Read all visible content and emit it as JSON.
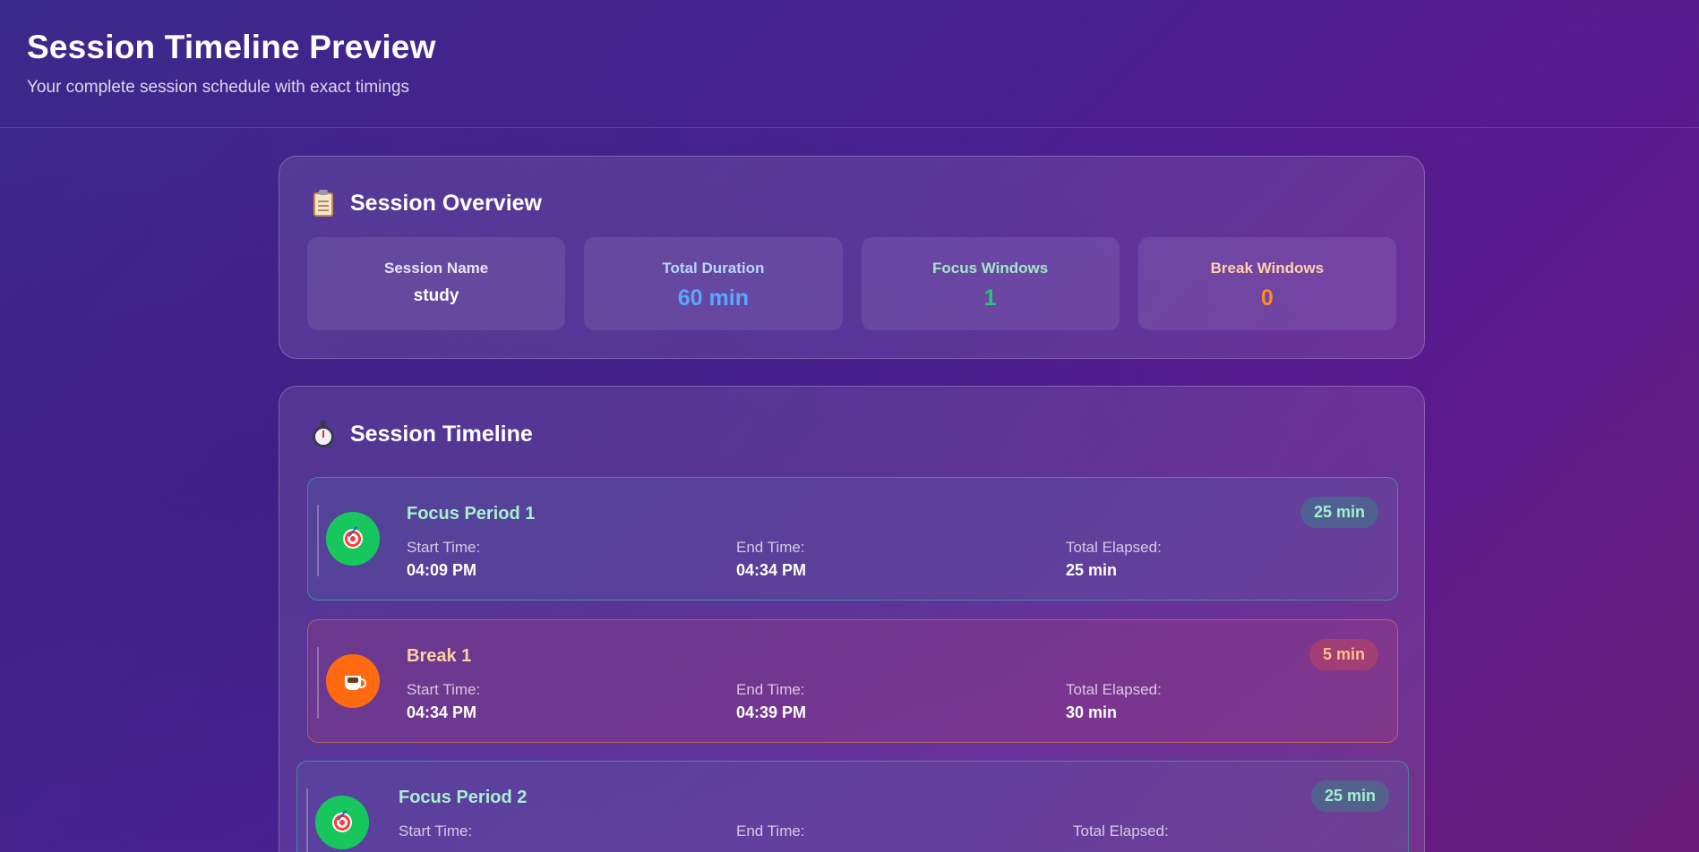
{
  "header": {
    "title": "Session Timeline Preview",
    "subtitle": "Your complete session schedule with exact timings"
  },
  "overview": {
    "heading": "Session Overview",
    "heading_icon": "clipboard-icon",
    "stats": [
      {
        "label": "Session Name",
        "value": "study"
      },
      {
        "label": "Total Duration",
        "value": "60 min"
      },
      {
        "label": "Focus Windows",
        "value": "1"
      },
      {
        "label": "Break Windows",
        "value": "0"
      }
    ]
  },
  "timeline": {
    "heading": "Session Timeline",
    "heading_icon": "stopwatch-icon",
    "periods": [
      {
        "type": "focus",
        "icon": "target-icon",
        "title": "Focus Period 1",
        "badge": "25 min",
        "start_label": "Start Time:",
        "start": "04:09 PM",
        "end_label": "End Time:",
        "end": "04:34 PM",
        "elapsed_label": "Total Elapsed:",
        "elapsed": "25 min"
      },
      {
        "type": "break",
        "icon": "coffee-icon",
        "title": "Break 1",
        "badge": "5 min",
        "start_label": "Start Time:",
        "start": "04:34 PM",
        "end_label": "End Time:",
        "end": "04:39 PM",
        "elapsed_label": "Total Elapsed:",
        "elapsed": "30 min"
      },
      {
        "type": "focus",
        "icon": "target-icon",
        "title": "Focus Period 2",
        "badge": "25 min",
        "start_label": "Start Time:",
        "start": "",
        "end_label": "End Time:",
        "end": "",
        "elapsed_label": "Total Elapsed:",
        "elapsed": ""
      }
    ]
  },
  "colors": {
    "duration_accent": "#5aa6ff",
    "focus_accent": "#22c77a",
    "break_accent": "#ff8a1f"
  }
}
